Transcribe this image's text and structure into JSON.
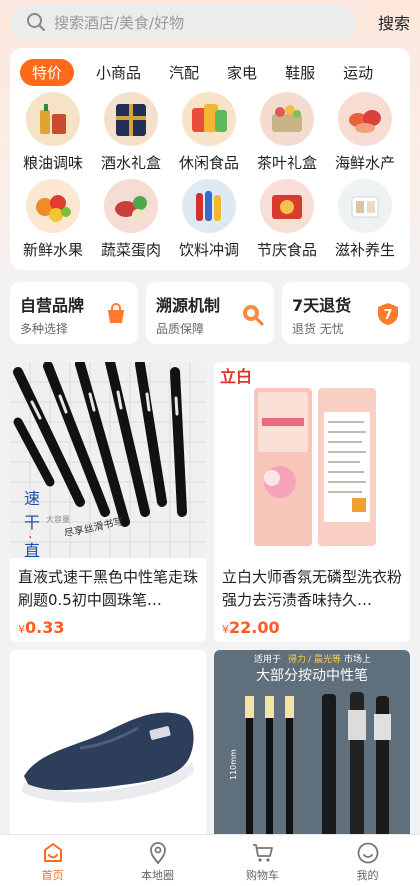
{
  "search": {
    "placeholder": "搜索酒店/美食/好物",
    "button": "搜索"
  },
  "tabs": [
    "特价",
    "小商品",
    "汽配",
    "家电",
    "鞋服",
    "运动"
  ],
  "categories": [
    {
      "label": "粮油调味",
      "icon": "grain-oil-icon",
      "color": "#f6d9b0"
    },
    {
      "label": "酒水礼盒",
      "icon": "liquor-gift-icon",
      "color": "#2a3355"
    },
    {
      "label": "休闲食品",
      "icon": "snack-icon",
      "color": "#f4c26a"
    },
    {
      "label": "茶叶礼盒",
      "icon": "tea-gift-icon",
      "color": "#f3d7c4"
    },
    {
      "label": "海鲜水产",
      "icon": "seafood-icon",
      "color": "#f1c3b7"
    },
    {
      "label": "新鲜水果",
      "icon": "fruit-icon",
      "color": "#f0a13c"
    },
    {
      "label": "蔬菜蛋肉",
      "icon": "vegetable-meat-icon",
      "color": "#d6534a"
    },
    {
      "label": "饮料冲调",
      "icon": "drink-icon",
      "color": "#3f78c2"
    },
    {
      "label": "节庆食品",
      "icon": "festival-food-icon",
      "color": "#d94b3c"
    },
    {
      "label": "滋补养生",
      "icon": "tonic-icon",
      "color": "#eeeeee"
    }
  ],
  "features": [
    {
      "title": "自营品牌",
      "sub": "多种选择",
      "icon": "bag-icon"
    },
    {
      "title": "溯源机制",
      "sub": "品质保障",
      "icon": "magnifier-icon"
    },
    {
      "title": "7天退货",
      "sub": "退货 无忧",
      "icon": "shield-seven-icon"
    }
  ],
  "products": [
    {
      "name": "直液式速干黑色中性笔走珠刷题0.5初中圆珠笔…",
      "currency": "¥",
      "price": "0.33",
      "image": "pens-photo",
      "image_text": [
        "速",
        "干",
        "·",
        "直",
        "液",
        "大容量",
        "尽享丝滑书写"
      ]
    },
    {
      "name": "立白大师香氛无磷型洗衣粉强力去污渍香味持久…",
      "currency": "¥",
      "price": "22.00",
      "image": "detergent-photo",
      "image_text": [
        "立白"
      ]
    },
    {
      "name": "",
      "currency": "",
      "price": "",
      "image": "shoe-photo",
      "image_text": []
    },
    {
      "name": "",
      "currency": "",
      "price": "",
      "image": "gel-pen-refill-photo",
      "image_text": [
        "适用于",
        "得力",
        "/",
        "晨光等",
        "市场上",
        "大部分按动中性笔",
        "110mm"
      ]
    }
  ],
  "tabbar": [
    {
      "label": "首页",
      "icon": "home-icon",
      "active": true
    },
    {
      "label": "本地圈",
      "icon": "location-icon",
      "active": false
    },
    {
      "label": "购物车",
      "icon": "cart-icon",
      "active": false
    },
    {
      "label": "我的",
      "icon": "profile-icon",
      "active": false
    }
  ],
  "colors": {
    "accent": "#ff6a1a",
    "price": "#ff5a1f"
  }
}
